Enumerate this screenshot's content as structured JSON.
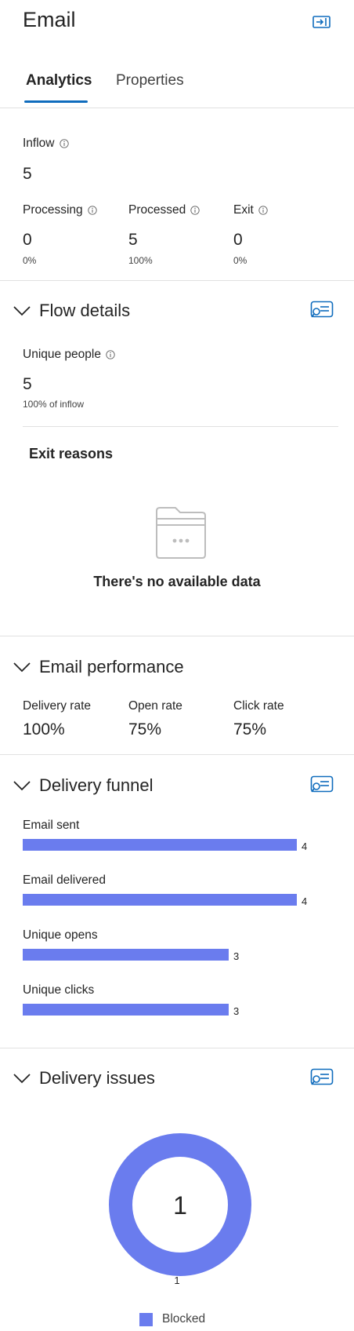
{
  "header": {
    "title": "Email"
  },
  "tabs": [
    {
      "label": "Analytics",
      "active": true
    },
    {
      "label": "Properties",
      "active": false
    }
  ],
  "summary": {
    "inflow": {
      "label": "Inflow",
      "value": "5"
    },
    "metrics": [
      {
        "label": "Processing",
        "value": "0",
        "percent": "0%"
      },
      {
        "label": "Processed",
        "value": "5",
        "percent": "100%"
      },
      {
        "label": "Exit",
        "value": "0",
        "percent": "0%"
      }
    ]
  },
  "flow_details": {
    "title": "Flow details",
    "unique_people": {
      "label": "Unique people",
      "value": "5",
      "sub": "100% of inflow"
    },
    "exit_reasons": {
      "title": "Exit reasons",
      "empty_text": "There's no available data"
    }
  },
  "email_performance": {
    "title": "Email performance",
    "metrics": [
      {
        "label": "Delivery rate",
        "value": "100%"
      },
      {
        "label": "Open rate",
        "value": "75%"
      },
      {
        "label": "Click rate",
        "value": "75%"
      }
    ]
  },
  "delivery_funnel": {
    "title": "Delivery funnel",
    "max": 4,
    "items": [
      {
        "label": "Email sent",
        "value": 4
      },
      {
        "label": "Email delivered",
        "value": 4
      },
      {
        "label": "Unique opens",
        "value": 3
      },
      {
        "label": "Unique clicks",
        "value": 3
      }
    ]
  },
  "delivery_issues": {
    "title": "Delivery issues",
    "center_value": "1",
    "slice_label": "1",
    "legend": "Blocked"
  },
  "colors": {
    "accent": "#0f6cbd",
    "bar": "#6a7cee",
    "divider": "#e1e1e1"
  },
  "icons": {
    "collapse": "panel-collapse-icon",
    "info": "info-icon",
    "chevron": "chevron-down-icon",
    "insight": "insights-icon",
    "empty": "empty-folder-icon"
  },
  "chart_data": [
    {
      "type": "bar",
      "title": "Delivery funnel",
      "categories": [
        "Email sent",
        "Email delivered",
        "Unique opens",
        "Unique clicks"
      ],
      "values": [
        4,
        4,
        3,
        3
      ]
    },
    {
      "type": "pie",
      "title": "Delivery issues",
      "categories": [
        "Blocked"
      ],
      "values": [
        1
      ]
    }
  ]
}
